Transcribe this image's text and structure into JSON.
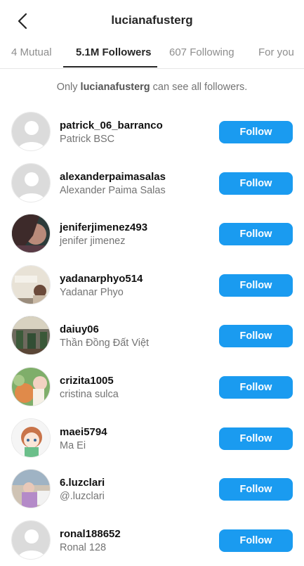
{
  "header": {
    "title": "lucianafusterg",
    "back_icon": "chevron-left-icon"
  },
  "tabs": [
    {
      "label": "4 Mutual",
      "active": false
    },
    {
      "label": "5.1M Followers",
      "active": true
    },
    {
      "label": "607 Following",
      "active": false
    },
    {
      "label": "For you",
      "active": false
    }
  ],
  "notice": {
    "prefix": "Only ",
    "username": "lucianafusterg",
    "suffix": " can see all followers."
  },
  "follow_button_color": "#1a9bf0",
  "followers": [
    {
      "username": "patrick_06_barranco",
      "name": "Patrick BSC",
      "button": "Follow",
      "avatar": "default-avatar"
    },
    {
      "username": "alexanderpaimasalas",
      "name": "Alexander Paima Salas",
      "button": "Follow",
      "avatar": "default-avatar"
    },
    {
      "username": "jeniferjimenez493",
      "name": "jenifer jimenez",
      "button": "Follow",
      "avatar": "photo-avatar"
    },
    {
      "username": "yadanarphyo514",
      "name": "Yadanar Phyo",
      "button": "Follow",
      "avatar": "photo-avatar"
    },
    {
      "username": "daiuy06",
      "name": "Thần Đồng Đất Việt",
      "button": "Follow",
      "avatar": "photo-avatar"
    },
    {
      "username": "crizita1005",
      "name": "cristina sulca",
      "button": "Follow",
      "avatar": "photo-avatar"
    },
    {
      "username": "maei5794",
      "name": "Ma Ei",
      "button": "Follow",
      "avatar": "anime-avatar"
    },
    {
      "username": "6.luzclari",
      "name": "@.luzclari",
      "button": "Follow",
      "avatar": "photo-avatar"
    },
    {
      "username": "ronal188652",
      "name": "Ronal 128",
      "button": "Follow",
      "avatar": "default-avatar"
    }
  ]
}
